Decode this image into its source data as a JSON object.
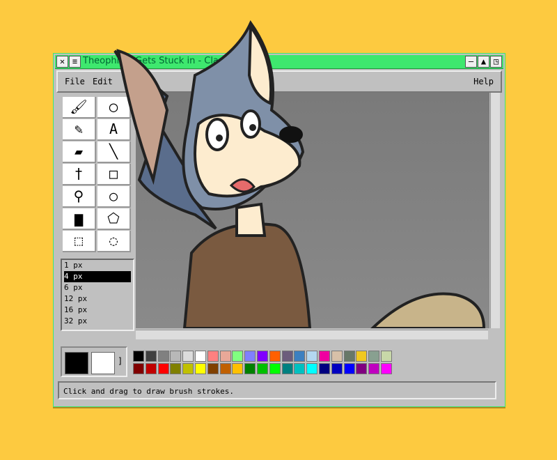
{
  "window": {
    "title": "Theophilus Gets Stuck in - Classic Paint"
  },
  "menu": {
    "file": "File",
    "edit": "Edit",
    "help": "Help"
  },
  "tools": [
    {
      "name": "brush",
      "glyph": "🖌"
    },
    {
      "name": "color-picker",
      "glyph": "◯"
    },
    {
      "name": "pencil",
      "glyph": "✎"
    },
    {
      "name": "text",
      "glyph": "A"
    },
    {
      "name": "eraser",
      "glyph": "▰"
    },
    {
      "name": "line",
      "glyph": "╲"
    },
    {
      "name": "eyedropper",
      "glyph": "†"
    },
    {
      "name": "rectangle",
      "glyph": "□"
    },
    {
      "name": "airbrush",
      "glyph": "⚲"
    },
    {
      "name": "ellipse",
      "glyph": "○"
    },
    {
      "name": "fill-bucket",
      "glyph": "▆"
    },
    {
      "name": "polygon",
      "glyph": "⬠"
    },
    {
      "name": "rect-select",
      "glyph": "⬚"
    },
    {
      "name": "free-select",
      "glyph": "◌"
    }
  ],
  "brush_sizes": [
    "1 px",
    "4 px",
    "6 px",
    "12 px",
    "16 px",
    "32 px"
  ],
  "selected_size": "4 px",
  "current_colors": {
    "foreground": "#000000",
    "background": "#ffffff",
    "bracket": "]"
  },
  "palette_row1": [
    "#000000",
    "#404040",
    "#808080",
    "#b8b8b8",
    "#dcdcdc",
    "#ffffff",
    "#ff8080",
    "#e8a898",
    "#80ff80",
    "#8080ff",
    "#8000ff",
    "#ff6000",
    "#6c5c7c",
    "#3c80c0",
    "#b4d8f0",
    "#f000a0",
    "#d8c0a8",
    "#687868",
    "#f0c820",
    "#88a090",
    "#c8d8a8"
  ],
  "palette_row2": [
    "#800000",
    "#c00000",
    "#ff0000",
    "#808000",
    "#c0c000",
    "#ffff00",
    "#804000",
    "#c06000",
    "#ffc000",
    "#008000",
    "#00c000",
    "#00ff00",
    "#008080",
    "#00c0c0",
    "#00ffff",
    "#000080",
    "#0000c0",
    "#0000ff",
    "#800080",
    "#c000c0",
    "#ff00ff"
  ],
  "status": "Click and drag to draw brush strokes."
}
